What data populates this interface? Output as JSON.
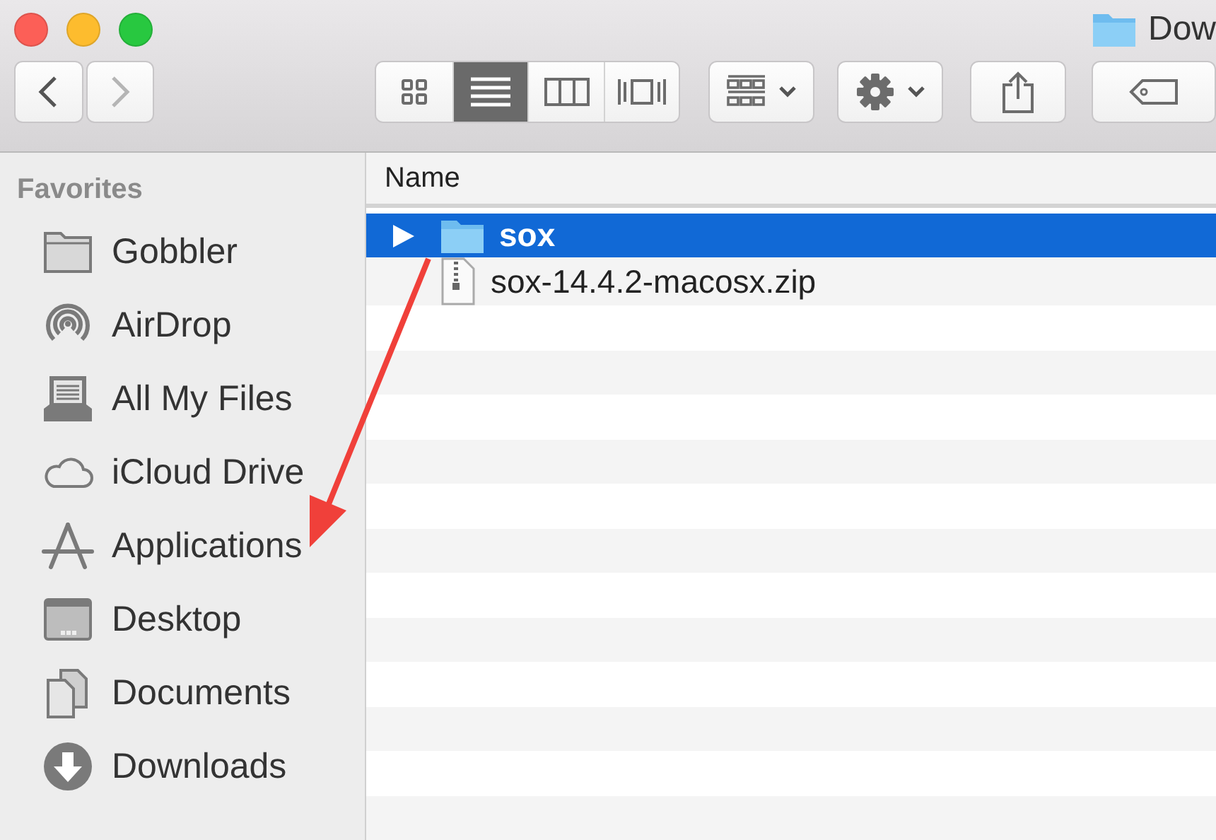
{
  "window": {
    "title": "Dow"
  },
  "toolbar": {
    "view_modes": [
      {
        "kind": "icons",
        "selected": false
      },
      {
        "kind": "list",
        "selected": true
      },
      {
        "kind": "columns",
        "selected": false
      },
      {
        "kind": "coverflow",
        "selected": false
      }
    ]
  },
  "sidebar": {
    "heading": "Favorites",
    "items": [
      {
        "label": "Gobbler",
        "kind": "folder"
      },
      {
        "label": "AirDrop",
        "kind": "airdrop"
      },
      {
        "label": "All My Files",
        "kind": "files"
      },
      {
        "label": "iCloud Drive",
        "kind": "cloud"
      },
      {
        "label": "Applications",
        "kind": "apps"
      },
      {
        "label": "Desktop",
        "kind": "desktop"
      },
      {
        "label": "Documents",
        "kind": "documents"
      },
      {
        "label": "Downloads",
        "kind": "downloads"
      }
    ]
  },
  "table": {
    "columns": [
      "Name"
    ],
    "rows": [
      {
        "name": "sox",
        "kind": "folder",
        "selected": true,
        "expanded": false
      },
      {
        "name": "sox-14.4.2-macosx.zip",
        "kind": "archive",
        "selected": false
      }
    ]
  }
}
